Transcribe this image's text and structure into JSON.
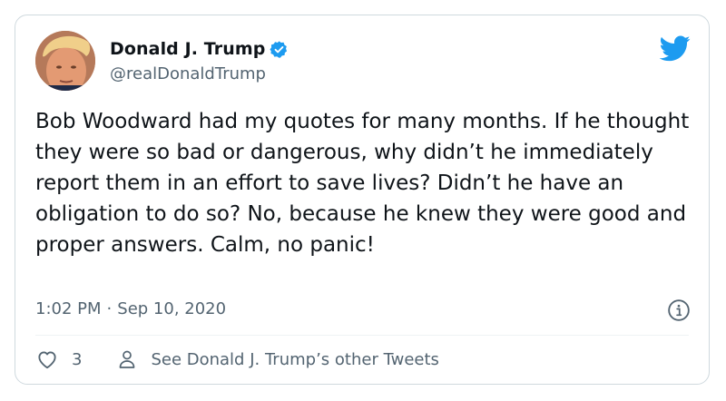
{
  "author": {
    "display_name": "Donald J. Trump",
    "handle": "@realDonaldTrump",
    "verified": true
  },
  "tweet": {
    "text": "Bob Woodward had my quotes for many months. If he thought they were so bad or dangerous, why didn’t he immediately report them in an effort to save lives? Didn’t he have an obligation to do so? No, because he knew they were good and proper answers. Calm, no panic!",
    "time": "1:02 PM",
    "separator": "·",
    "date": "Sep 10, 2020"
  },
  "actions": {
    "like_count": "3",
    "see_other_label": "See Donald J. Trump’s other Tweets"
  },
  "icons": {
    "avatar": "avatar",
    "verified": "verified-badge-icon",
    "brand": "twitter-bird-icon",
    "info": "info-icon",
    "like": "heart-icon",
    "profile": "person-icon"
  },
  "colors": {
    "brand_blue": "#1d9bf0",
    "secondary_text": "#536471",
    "primary_text": "#0f1419",
    "border": "#cfd9de"
  }
}
